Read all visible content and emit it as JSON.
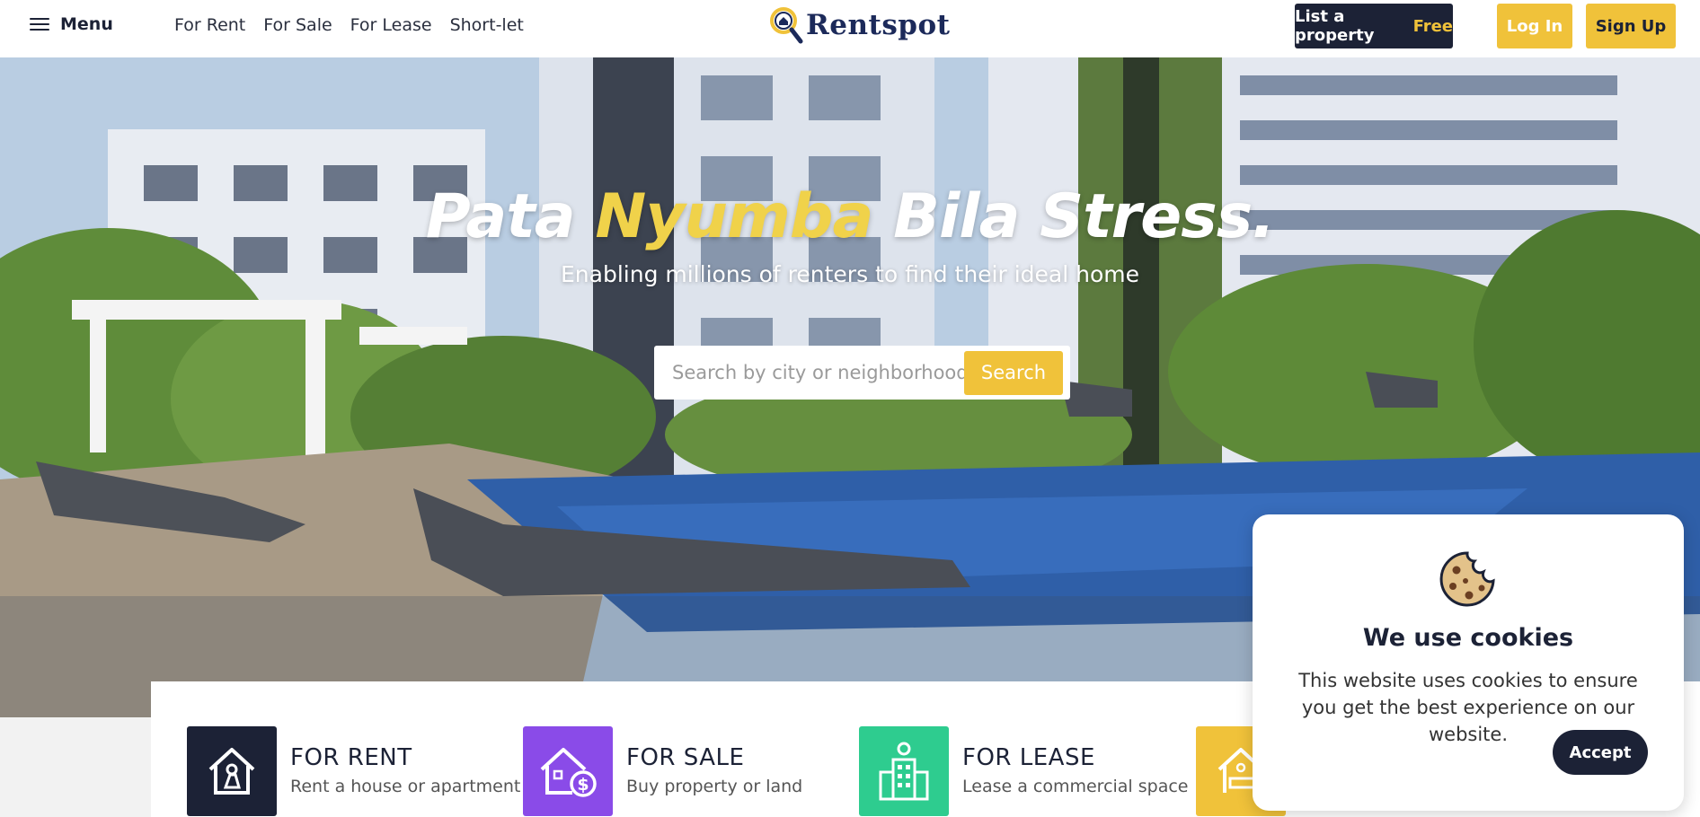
{
  "header": {
    "menu_label": "Menu",
    "nav": [
      {
        "label": "For Rent"
      },
      {
        "label": "For Sale"
      },
      {
        "label": "For Lease"
      },
      {
        "label": "Short-let"
      }
    ],
    "logo_text": "Rentspot",
    "list_property_label": "List a property",
    "list_property_badge": "Free",
    "login_label": "Log In",
    "signup_label": "Sign Up"
  },
  "hero": {
    "title_part1": "Pata",
    "title_accent": "Nyumba",
    "title_part2": "Bila Stress.",
    "subtitle": "Enabling millions of renters to find their ideal home",
    "search_placeholder": "Search by city or neighborhood",
    "search_button": "Search"
  },
  "categories": [
    {
      "title": "FOR RENT",
      "desc": "Rent a house or apartment",
      "color": "#1c2236",
      "icon": "house-key-icon"
    },
    {
      "title": "FOR SALE",
      "desc": "Buy property or land",
      "color": "#8a4be8",
      "icon": "house-dollar-icon"
    },
    {
      "title": "FOR LEASE",
      "desc": "Lease a commercial space",
      "color": "#2ecc8f",
      "icon": "office-building-icon"
    },
    {
      "title": "",
      "desc": "",
      "color": "#f0c23a",
      "icon": "house-bed-icon"
    }
  ],
  "cookie": {
    "title": "We use cookies",
    "text": "This website uses cookies to ensure you get the best experience on our website.",
    "accept_label": "Accept",
    "icon": "cookie-icon"
  },
  "colors": {
    "navy": "#1c2236",
    "yellow": "#f0c23a",
    "accent_title": "#f0d24a"
  }
}
